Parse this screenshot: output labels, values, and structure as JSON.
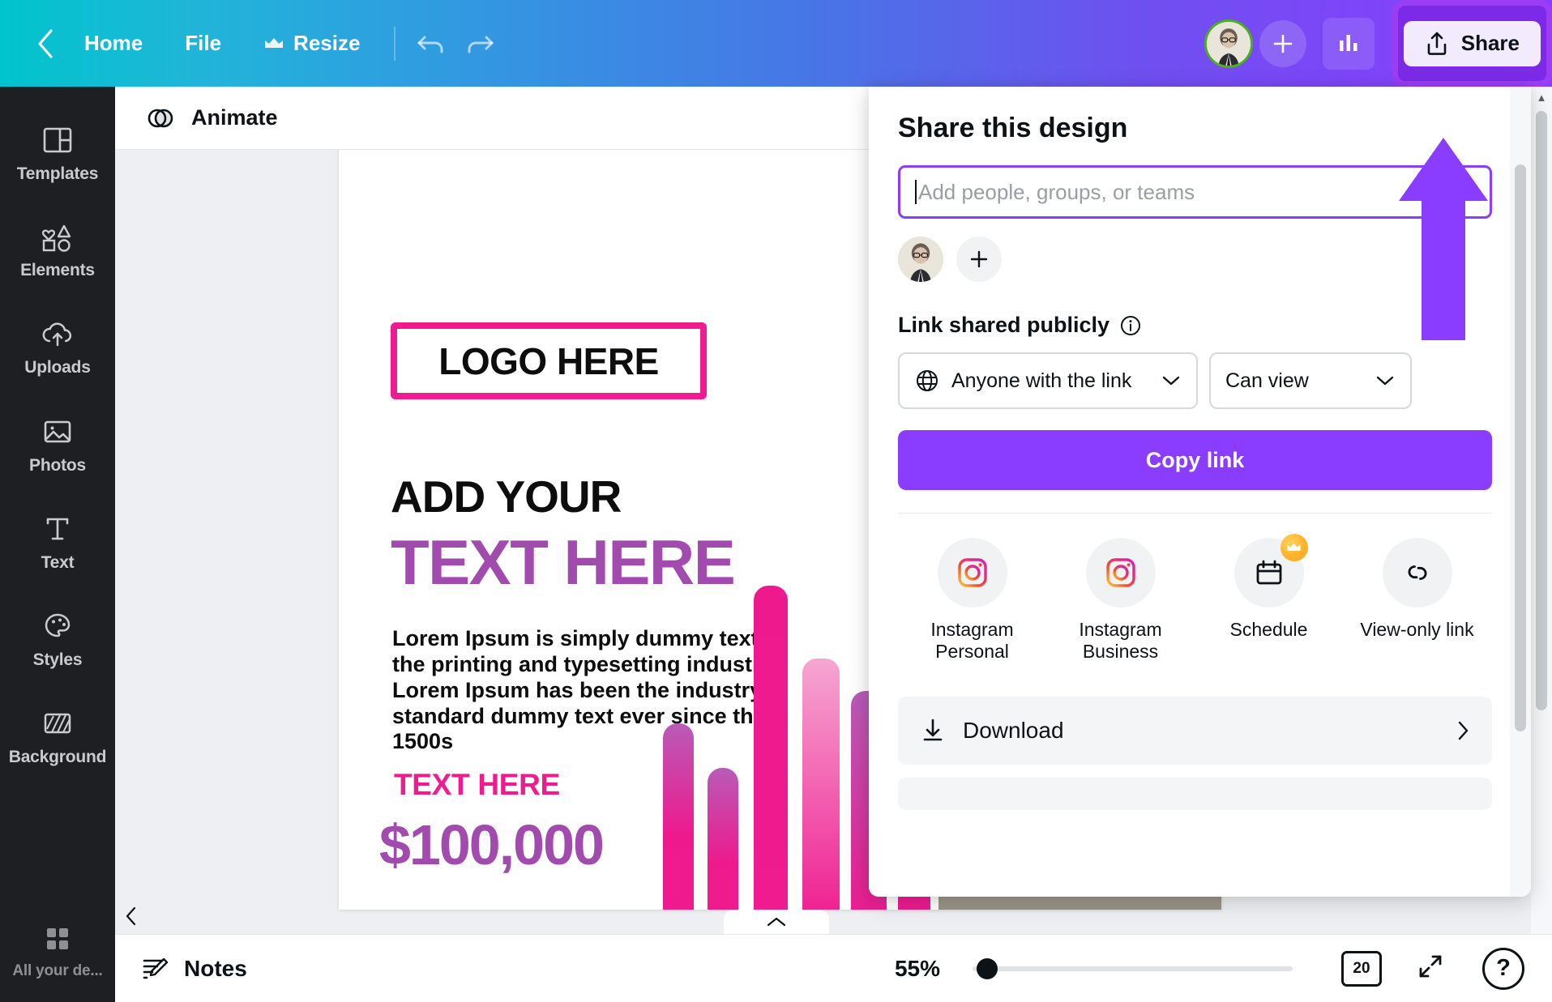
{
  "topbar": {
    "back_icon": "chevron-left-icon",
    "home_label": "Home",
    "file_label": "File",
    "resize_label": "Resize",
    "resize_crown_icon": "crown-icon",
    "undo_icon": "undo-icon",
    "redo_icon": "redo-icon",
    "avatar_icon": "user-avatar",
    "add_collaborator_icon": "plus-icon",
    "stats_icon": "bar-chart-icon",
    "share_label": "Share",
    "share_icon": "upload-share-icon",
    "highlight_color": "#9b3df5",
    "gradient_start": "#00c4cc",
    "gradient_end": "#8b3dff"
  },
  "sidebar": {
    "items": [
      {
        "label": "Templates",
        "icon": "templates-icon"
      },
      {
        "label": "Elements",
        "icon": "elements-icon"
      },
      {
        "label": "Uploads",
        "icon": "uploads-cloud-icon"
      },
      {
        "label": "Photos",
        "icon": "photos-image-icon"
      },
      {
        "label": "Text",
        "icon": "text-t-icon"
      },
      {
        "label": "Styles",
        "icon": "styles-palette-icon"
      },
      {
        "label": "Background",
        "icon": "background-icon"
      }
    ],
    "bottom_item": {
      "label": "All your de...",
      "icon": "grid-apps-icon"
    }
  },
  "editor_toolbar": {
    "animate_label": "Animate",
    "animate_icon": "animate-circles-icon"
  },
  "canvas": {
    "logo_text": "LOGO HERE",
    "heading_top": "ADD YOUR",
    "heading_main": "TEXT HERE",
    "body_text": "Lorem Ipsum is simply dummy text of the printing and typesetting industry. Lorem Ipsum has been the industry's standard dummy text ever since the 1500s",
    "subheading": "TEXT HERE",
    "price": "$100,000",
    "accent_pink": "#ef1b8f",
    "accent_purple": "#a04bad",
    "scroll_left_icon": "chevron-left-icon",
    "scroll_right_icon": "chevron-right-icon"
  },
  "share_panel": {
    "title": "Share this design",
    "input_placeholder": "Add people, groups, or teams",
    "input_value": "",
    "add_person_icon": "plus-icon",
    "avatar_icon": "user-avatar",
    "link_status_label": "Link shared publicly",
    "info_icon": "info-circle-icon",
    "access_select": {
      "value": "Anyone with the link",
      "icon": "globe-icon",
      "chevron": "chevron-down-icon"
    },
    "permission_select": {
      "value": "Can view",
      "chevron": "chevron-down-icon"
    },
    "copy_link_label": "Copy link",
    "copy_link_color": "#8b3dff",
    "social": [
      {
        "label": "Instagram Personal",
        "icon": "instagram-icon",
        "pro": false
      },
      {
        "label": "Instagram Business",
        "icon": "instagram-icon",
        "pro": false
      },
      {
        "label": "Schedule",
        "icon": "calendar-icon",
        "pro": true
      },
      {
        "label": "View-only link",
        "icon": "link-chain-icon",
        "pro": false
      }
    ],
    "download_label": "Download",
    "download_icon": "download-icon",
    "download_chevron": "chevron-right-icon"
  },
  "annotation": {
    "arrow_icon": "up-arrow-annotation",
    "arrow_color": "#8b3dff"
  },
  "bottombar": {
    "notes_label": "Notes",
    "notes_icon": "notes-pencil-icon",
    "zoom_level": "55%",
    "pages_count": "20",
    "pages_icon": "pages-icon",
    "expand_icon": "expand-fullscreen-icon",
    "help_label": "?",
    "help_icon": "help-circle-icon",
    "collapse_icon": "chevron-up-icon"
  }
}
